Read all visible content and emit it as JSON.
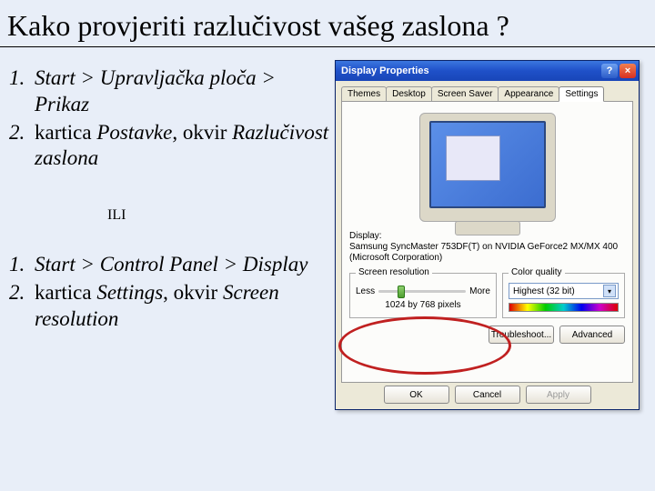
{
  "title": "Kako provjeriti razlučivost vašeg zaslona ?",
  "listA": {
    "n1": "1.",
    "t1a": "Start > Upravljačka ploča > Prikaz",
    "n2": "2.",
    "t2a": "kartica ",
    "t2b": "Postavke",
    "t2c": ", okvir ",
    "t2d": "Razlučivost zaslona"
  },
  "ili": "ILI",
  "listB": {
    "n1": "1.",
    "t1a": "Start > Control Panel > Display",
    "n2": "2.",
    "t2a": "kartica ",
    "t2b": "Settings",
    "t2c": ", okvir ",
    "t2d": "Screen resolution"
  },
  "dialog": {
    "title": "Display Properties",
    "tabs": {
      "t1": "Themes",
      "t2": "Desktop",
      "t3": "Screen Saver",
      "t4": "Appearance",
      "t5": "Settings"
    },
    "displayLabel": "Display:",
    "displayValue1": "Samsung SyncMaster 753DF(T) on NVIDIA GeForce2 MX/MX 400",
    "displayValue2": "(Microsoft Corporation)",
    "groupRes": "Screen resolution",
    "less": "Less",
    "more": "More",
    "resVal": "1024 by 768 pixels",
    "groupCQ": "Color quality",
    "cqVal": "Highest (32 bit)",
    "troubleshoot": "Troubleshoot...",
    "advanced": "Advanced",
    "ok": "OK",
    "cancel": "Cancel",
    "apply": "Apply"
  }
}
